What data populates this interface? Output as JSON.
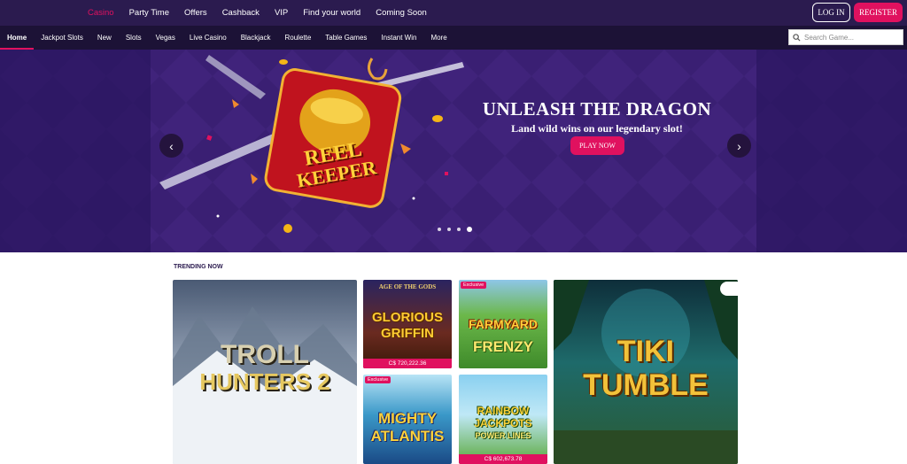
{
  "topnav": {
    "items": [
      {
        "label": "Casino",
        "active": true
      },
      {
        "label": "Party Time"
      },
      {
        "label": "Offers"
      },
      {
        "label": "Cashback"
      },
      {
        "label": "VIP"
      },
      {
        "label": "Find your world"
      },
      {
        "label": "Coming Soon"
      }
    ],
    "login_label": "LOG IN",
    "register_label": "REGISTER"
  },
  "subnav": {
    "items": [
      "Home",
      "Jackpot Slots",
      "New",
      "Slots",
      "Vegas",
      "Live Casino",
      "Blackjack",
      "Roulette",
      "Table Games",
      "Instant Win",
      "More"
    ],
    "active_index": 0
  },
  "search": {
    "placeholder": "Search Game..."
  },
  "hero": {
    "title": "UNLEASH THE DRAGON",
    "subtitle": "Land wild wins on our legendary slot!",
    "cta_label": "PLAY NOW",
    "game_logo_line1": "REEL",
    "game_logo_line2": "KEEPER",
    "slide_count": 4,
    "active_slide": 3
  },
  "trending": {
    "title": "TRENDING NOW",
    "games": [
      {
        "line1": "TROLL",
        "line2": "HUNTERS 2"
      },
      {
        "top": "AGE OF THE GODS",
        "line1": "GLORIOUS",
        "line2": "GRIFFIN",
        "jackpot": "C$ 720,222.36"
      },
      {
        "badge": "Exclusive",
        "line1": "FARMYARD",
        "line2": "FRENZY"
      },
      {
        "badge": "Exclusive",
        "line1": "MIGHTY",
        "line2": "ATLANTIS"
      },
      {
        "line1": "RAINBOW",
        "line2": "JACKPOTS",
        "line3": "POWER LINES",
        "jackpot": "C$ 602,673.78"
      },
      {
        "line1": "TIKI",
        "line2": "TUMBLE"
      }
    ]
  },
  "colors": {
    "accent": "#e0115f",
    "header_bg": "#2b1b4f",
    "subnav_bg": "#1c1236",
    "hero_bg": "#3a1f73"
  }
}
